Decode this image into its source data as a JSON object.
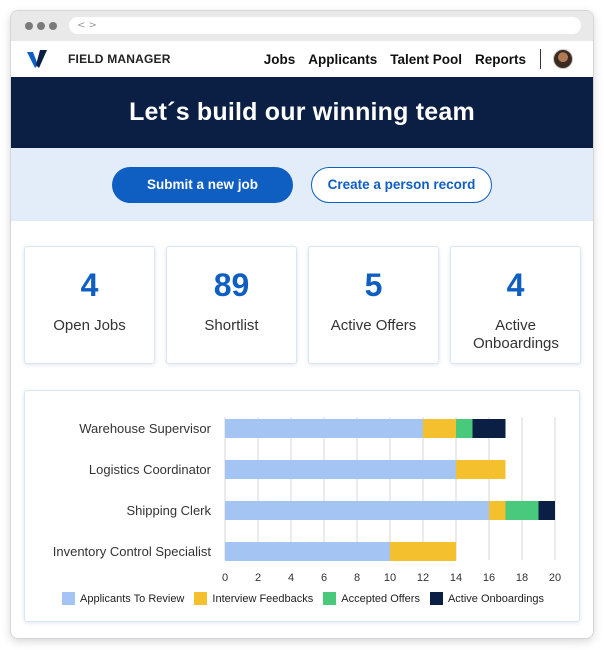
{
  "browser": {
    "address_text": "< >"
  },
  "nav": {
    "brand": "FIELD MANAGER",
    "links": [
      "Jobs",
      "Applicants",
      "Talent Pool",
      "Reports"
    ]
  },
  "hero": {
    "title": "Let´s build our winning team"
  },
  "actions": {
    "primary_label": "Submit a new job",
    "secondary_label": "Create a person record"
  },
  "stats": [
    {
      "value": "4",
      "label": "Open Jobs"
    },
    {
      "value": "89",
      "label": "Shortlist"
    },
    {
      "value": "5",
      "label": "Active Offers"
    },
    {
      "value": "4",
      "label": "Active Onboardings"
    }
  ],
  "colors": {
    "accent": "#0f5ec2",
    "hero_bg": "#0b1f45",
    "actions_bg": "#e3edf9"
  },
  "chart_data": {
    "type": "bar",
    "orientation": "horizontal",
    "stacked": true,
    "categories": [
      "Warehouse Supervisor",
      "Logistics Coordinator",
      "Shipping Clerk",
      "Inventory Control Specialist"
    ],
    "series": [
      {
        "name": "Applicants To Review",
        "color": "#a4c4f4",
        "values": [
          12,
          14,
          16,
          10
        ]
      },
      {
        "name": "Interview Feedbacks",
        "color": "#f4c02e",
        "values": [
          2,
          3,
          1,
          4
        ]
      },
      {
        "name": "Accepted Offers",
        "color": "#48c97b",
        "values": [
          1,
          0,
          2,
          0
        ]
      },
      {
        "name": "Active Onboardings",
        "color": "#0b1f45",
        "values": [
          2,
          0,
          1,
          0
        ]
      }
    ],
    "xlim": [
      0,
      20
    ],
    "xticks": [
      "0",
      "2",
      "4",
      "6",
      "8",
      "10",
      "12",
      "14",
      "16",
      "18",
      "20"
    ],
    "grid": true,
    "legend_position": "bottom"
  }
}
